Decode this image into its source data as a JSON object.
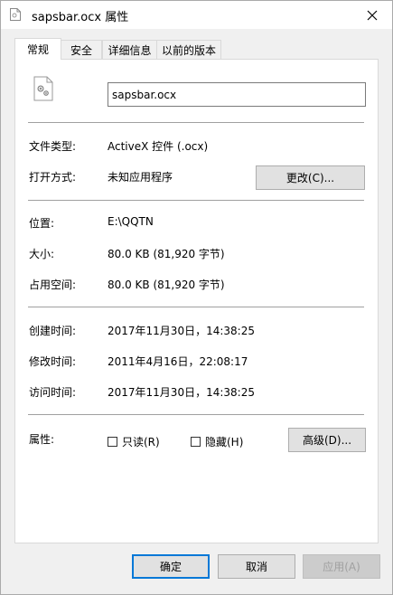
{
  "window": {
    "title": "sapsbar.ocx 属性",
    "close_glyph": "×"
  },
  "tabs": [
    {
      "label": "常规",
      "active": true
    },
    {
      "label": "安全",
      "active": false
    },
    {
      "label": "详细信息",
      "active": false
    },
    {
      "label": "以前的版本",
      "active": false
    }
  ],
  "general": {
    "file_name": "sapsbar.ocx",
    "file_type_label": "文件类型:",
    "file_type_value": "ActiveX 控件 (.ocx)",
    "opens_with_label": "打开方式:",
    "opens_with_value": "未知应用程序",
    "change_button": "更改(C)...",
    "location_label": "位置:",
    "location_value": "E:\\QQTN",
    "size_label": "大小:",
    "size_value": "80.0 KB (81,920 字节)",
    "size_on_disk_label": "占用空间:",
    "size_on_disk_value": "80.0 KB (81,920 字节)",
    "created_label": "创建时间:",
    "created_value": "2017年11月30日，14:38:25",
    "modified_label": "修改时间:",
    "modified_value": "2011年4月16日，22:08:17",
    "accessed_label": "访问时间:",
    "accessed_value": "2017年11月30日，14:38:25",
    "attributes_label": "属性:",
    "readonly_label": "只读(R)",
    "readonly_checked": false,
    "hidden_label": "隐藏(H)",
    "hidden_checked": false,
    "advanced_button": "高级(D)..."
  },
  "footer": {
    "ok": "确定",
    "cancel": "取消",
    "apply": "应用(A)"
  },
  "colors": {
    "accent": "#0078d7",
    "panel_bg": "#ffffff",
    "window_bg": "#f0f0f0"
  }
}
